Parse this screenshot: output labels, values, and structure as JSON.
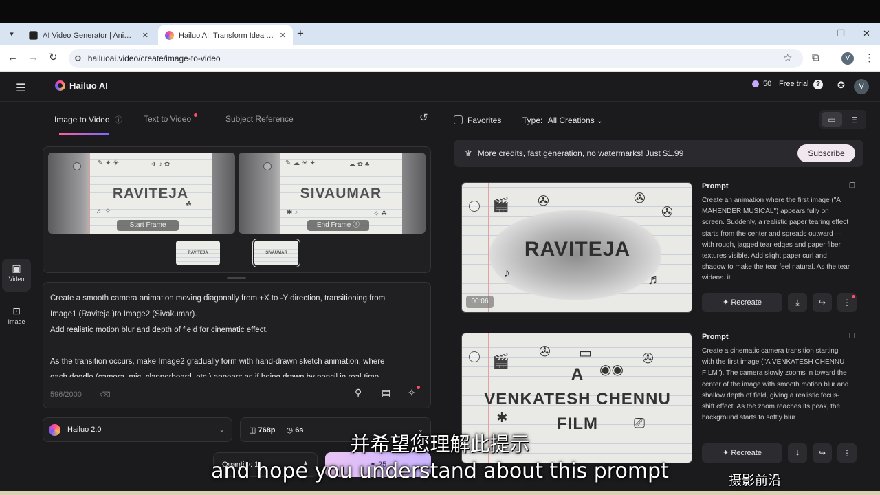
{
  "browser": {
    "tabs": [
      {
        "title": "AI Video Generator | Animate P",
        "active": false
      },
      {
        "title": "Hailuo AI: Transform Idea to Vi",
        "active": true
      }
    ],
    "url": "hailuoai.video/create/image-to-video",
    "profile_initial": "V"
  },
  "header": {
    "brand": "Hailuo AI",
    "credits": "50",
    "free_trial": "Free trial",
    "avatar_initial": "V"
  },
  "rail": [
    {
      "label": "Video",
      "icon": "video-icon",
      "active": true
    },
    {
      "label": "Image",
      "icon": "image-icon",
      "active": false
    }
  ],
  "modes": {
    "tabs": [
      "Image to Video",
      "Text to Video",
      "Subject Reference"
    ],
    "active": "Image to Video"
  },
  "frames": {
    "start": {
      "word": "RAVITEJA",
      "label": "Start Frame"
    },
    "end": {
      "word": "SIVAUMAR",
      "label": "End Frame"
    },
    "thumb_start": "RAVITEJA",
    "thumb_end": "SIVAUMAR"
  },
  "prompt": {
    "lines": [
      "Create a smooth camera animation moving diagonally from +X to -Y direction, transitioning from",
      "Image1 (Raviteja )to Image2 (Sivakumar).",
      "Add realistic motion blur and depth of field for cinematic effect.",
      "",
      "As the transition occurs, make Image2 gradually form with hand-drawn sketch animation, where",
      "each doodle (camera, mic, clapperboard, etc.) appears as if being drawn by pencil in real-time."
    ],
    "char_count": "596/2000"
  },
  "settings": {
    "model": "Hailuo 2.0",
    "resolution": "768p",
    "duration": "6s",
    "quantity_label": "Quantity: 1",
    "generate_label": "25"
  },
  "gallery": {
    "favorites_label": "Favorites",
    "type_label": "Type:",
    "type_value": "All Creations",
    "promo_text": "More credits, fast generation, no watermarks! Just $1.99",
    "subscribe_label": "Subscribe",
    "items": [
      {
        "image_word": "RAVITEJA",
        "time": "00:06",
        "prompt_title": "Prompt",
        "prompt_text": "Create an animation where the first image (\"A MAHENDER MUSICAL\") appears fully on screen. Suddenly, a realistic paper tearing effect starts from the center and spreads outward — with rough, jagged tear edges and paper fiber textures visible. Add slight paper curl and shadow to make the tear feel natural. As the tear widens, it",
        "recreate_label": "Recreate"
      },
      {
        "image_words": [
          "A",
          "VENKATESH CHENNU",
          "FILM"
        ],
        "prompt_title": "Prompt",
        "prompt_text": "Create a cinematic camera transition starting with the first image (\"A VENKATESH CHENNU FILM\"). The camera slowly zooms in toward the center of the image with smooth motion blur and shallow depth of field, giving a realistic focus-shift effect. As the zoom reaches its peak, the background starts to softly blur",
        "recreate_label": "Recreate"
      }
    ]
  },
  "subtitles": {
    "cn": "并希望您理解此提示",
    "en": "and hope you understand about this prompt",
    "watermark": "摄影前沿 sheyingzyz.com"
  }
}
